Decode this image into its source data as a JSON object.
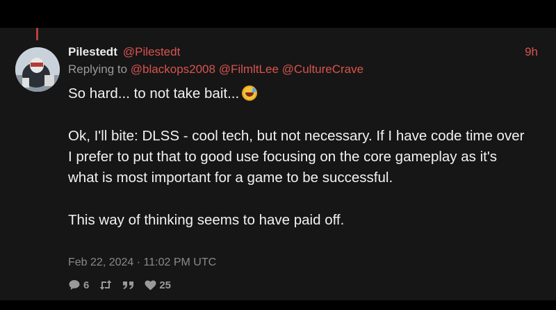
{
  "post": {
    "author_name": "Pilestedt",
    "author_handle": "@Pilestedt",
    "time_ago": "9h",
    "replying_to_label": "Replying to",
    "mentions": [
      "@blackops2008",
      "@FilmltLee",
      "@CultureCrave"
    ],
    "paragraphs": [
      "So hard... to not take bait...",
      "Ok, I'll bite: DLSS - cool tech, but not necessary. If I have code time over I prefer to put that to good use focusing on the core gameplay as it's what is most important for a game to be successful.",
      "This way of thinking seems to have paid off."
    ],
    "emoji": "rolling-on-floor-laughing",
    "date": "Feb 22, 2024",
    "separator": "·",
    "time": "11:02 PM UTC",
    "stats": {
      "comments": "6",
      "retweets": "",
      "quotes": "",
      "likes": "25"
    }
  },
  "colors": {
    "accent": "#d9534f",
    "background": "#161616",
    "text": "#f2f2f2",
    "muted": "#9a9a9a"
  }
}
